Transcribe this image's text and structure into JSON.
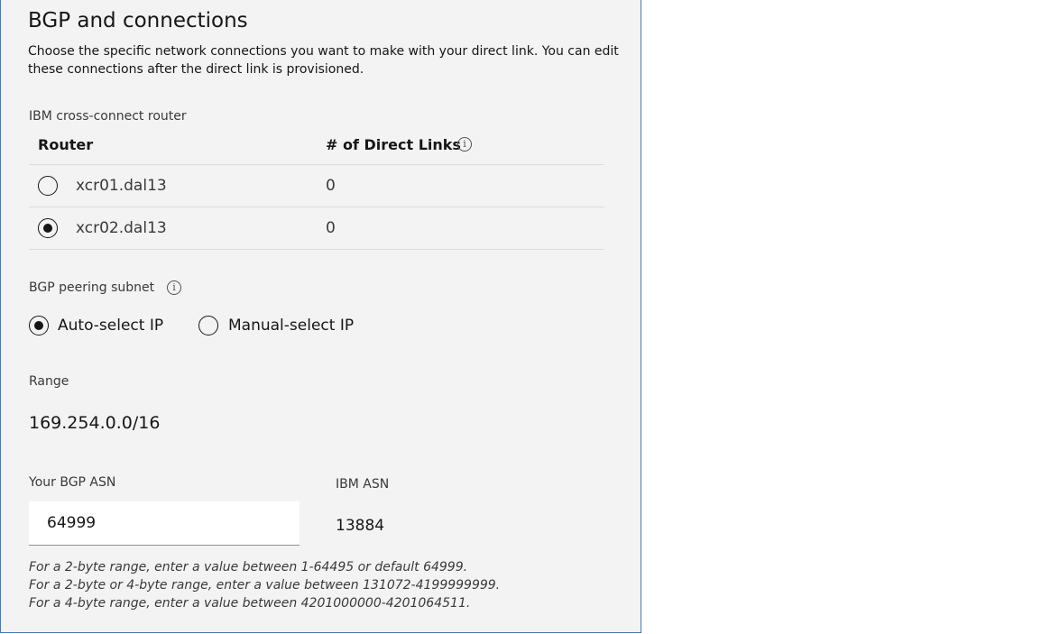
{
  "section": {
    "title": "BGP and connections",
    "description": "Choose the specific network connections you want to make with your direct link. You can edit these connections after the direct link is provisioned."
  },
  "router_table": {
    "label": "IBM cross-connect router",
    "col_router": "Router",
    "col_links": "# of Direct Links",
    "info_icon": "info-icon",
    "rows": [
      {
        "router": "xcr01.dal13",
        "links": "0",
        "selected": false
      },
      {
        "router": "xcr02.dal13",
        "links": "0",
        "selected": true
      }
    ]
  },
  "bgp_subnet": {
    "label": "BGP peering subnet",
    "options": [
      {
        "label": "Auto-select IP",
        "selected": true
      },
      {
        "label": "Manual-select IP",
        "selected": false
      }
    ]
  },
  "range": {
    "label": "Range",
    "value": "169.254.0.0/16"
  },
  "asn": {
    "your_label": "Your BGP ASN",
    "your_value": "64999",
    "ibm_label": "IBM ASN",
    "ibm_value": "13884",
    "helper": [
      "For a 2-byte range, enter a value between 1-64495 or default 64999.",
      "For a 2-byte or 4-byte range, enter a value between 131072-4199999999.",
      "For a 4-byte range, enter a value between 4201000000-4201064511."
    ]
  },
  "colors": {
    "panel_bg": "#f3f3f3",
    "panel_border": "#4a73b8",
    "text": "#161616"
  }
}
